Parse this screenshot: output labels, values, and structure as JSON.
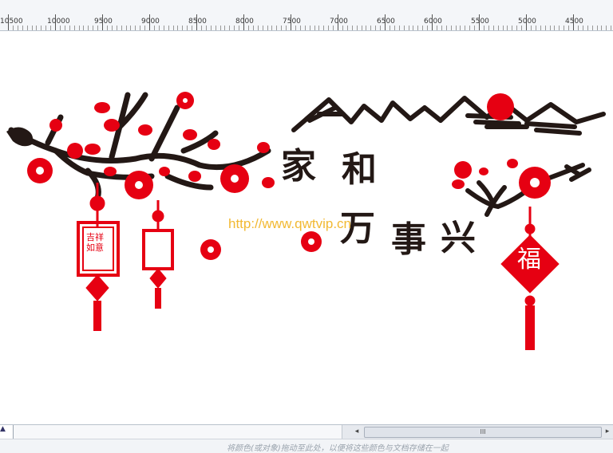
{
  "ruler": {
    "labels": [
      "10500",
      "10000",
      "9500",
      "9000",
      "8500",
      "8000",
      "7500",
      "7000",
      "6500",
      "6000",
      "5500",
      "5000",
      "4500"
    ]
  },
  "canvas": {
    "watermark": "http://www.qwtvip.cn",
    "calligraphy": [
      "家",
      "和",
      "万",
      "事",
      "兴"
    ],
    "fu_char": "福",
    "lantern_left_chars": [
      "吉",
      "祥",
      "如",
      "意"
    ],
    "colors": {
      "plum_red": "#e60012",
      "branch_black": "#231815",
      "watermark": "#f2b933"
    }
  },
  "scrollbar": {
    "thumb_grip": "III",
    "left_arrow": "◂",
    "right_arrow": "▸",
    "tab_label": "▲"
  },
  "status": {
    "hint": "将颜色(或对象)拖动至此处，以便将这些颜色与文档存储在一起"
  }
}
